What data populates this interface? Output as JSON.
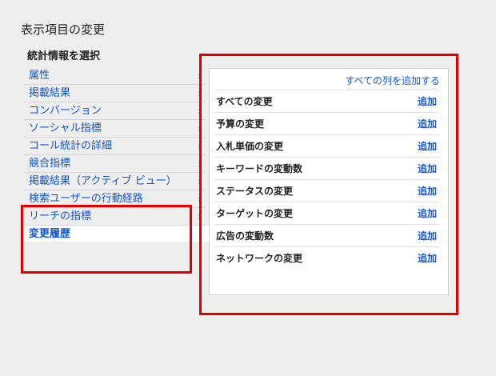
{
  "page_title": "表示項目の変更",
  "section_title": "統計情報を選択",
  "categories": [
    {
      "label": "属性"
    },
    {
      "label": "掲載結果"
    },
    {
      "label": "コンバージョン"
    },
    {
      "label": "ソーシャル指標"
    },
    {
      "label": "コール統計の詳細"
    },
    {
      "label": "競合指標"
    },
    {
      "label": "掲載結果（アクティブ ビュー）"
    },
    {
      "label": "検索ユーザーの行動経路"
    },
    {
      "label": "リーチの指標"
    },
    {
      "label": "変更履歴",
      "selected": true
    }
  ],
  "chevron_glyph": "›",
  "panel": {
    "add_all_label": "すべての列を追加する",
    "add_label": "追加",
    "columns": [
      {
        "name": "すべての変更"
      },
      {
        "name": "予算の変更"
      },
      {
        "name": "入札単価の変更"
      },
      {
        "name": "キーワードの変動数"
      },
      {
        "name": "ステータスの変更"
      },
      {
        "name": "ターゲットの変更"
      },
      {
        "name": "広告の変動数"
      },
      {
        "name": "ネットワークの変更"
      }
    ]
  },
  "colors": {
    "link": "#1155cc",
    "highlight_border": "#e00000",
    "background": "#eeeeee"
  }
}
